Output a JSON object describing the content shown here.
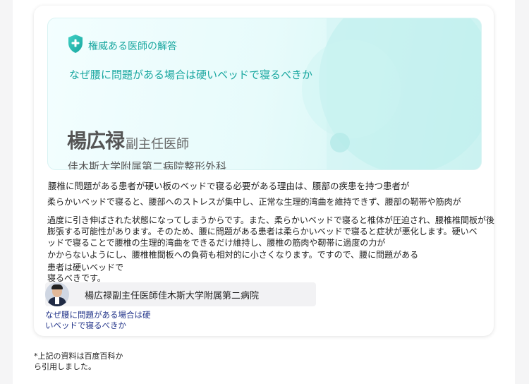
{
  "answer_card": {
    "badge_label": "権威ある医師の解答",
    "question": "なぜ腰に問題がある場合は硬いベッドで寝るべきか",
    "doctor": {
      "name": "楊広禄",
      "title": "副主任医師",
      "hospital": "佳木斯大学附属第二病院整形外科"
    },
    "body_lines": [
      "腰椎に問題がある患者が硬い板のベッドで寝る必要がある理由は、腰部の疾患を持つ患者が",
      "柔らかいベッドで寝ると、腰部へのストレスが集中し、正常な生理的湾曲を維持できず、腰部の靭帯や筋肉が",
      "過度に引き伸ばされた状態になってしまうからです。また、柔らかいベッドで寝ると椎体が圧迫され、腰椎椎間板が後",
      "膨張する可能性があります。そのため、腰に問題がある患者は柔らかいベッドで寝ると症状が悪化します。硬いベ",
      "ッドで寝ることで腰椎の生理的湾曲をできるだけ維持し、腰椎の筋肉や靭帯に過度の力が",
      "かからないようにし、腰椎椎間板への負荷も相対的に小さくなります。ですので、腰に問題がある",
      "患者は硬いベッドで",
      "寝るべきです。"
    ],
    "author_chip": "楊広禄副主任医師佳木斯大学附属第二病院",
    "related_link": [
      "なぜ腰に問題がある場合は硬",
      "いベッドで寝るべきか"
    ]
  },
  "footnote": [
    "*上記の資料は百度百科か",
    "ら引用しました。"
  ],
  "colors": {
    "accent": "#1aa7a0",
    "link": "#23358a",
    "banner_start": "#f3feff",
    "banner_end": "#ccf3f1"
  },
  "icons": {
    "badge": "shield-plus-icon"
  }
}
